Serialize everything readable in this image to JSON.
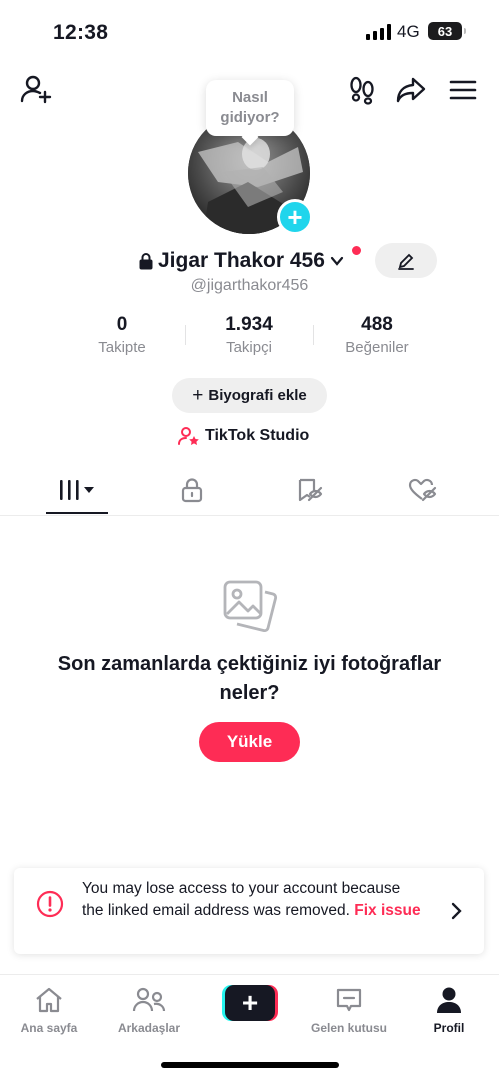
{
  "status_bar": {
    "time": "12:38",
    "network": "4G",
    "battery": "63"
  },
  "profile": {
    "bubble": "Nasıl gidiyor?",
    "name": "Jigar Thakor 456",
    "username": "@jigarthakor456",
    "stats": [
      {
        "value": "0",
        "label": "Takipte"
      },
      {
        "value": "1.934",
        "label": "Takipçi"
      },
      {
        "value": "488",
        "label": "Beğeniler"
      }
    ],
    "bio_button": "Biyografi ekle",
    "studio": "TikTok Studio"
  },
  "empty_state": {
    "title": "Son zamanlarda çektiğiniz iyi fotoğraflar neler?",
    "button": "Yükle"
  },
  "warning": {
    "text": "You may lose access to your account because the linked email address was removed.",
    "link": "Fix issue"
  },
  "nav": {
    "home": "Ana sayfa",
    "friends": "Arkadaşlar",
    "inbox": "Gelen kutusu",
    "profile": "Profil"
  },
  "colors": {
    "accent": "#fe2c55",
    "cyan": "#25f4ee",
    "avatar_add": "#20d5ec"
  }
}
